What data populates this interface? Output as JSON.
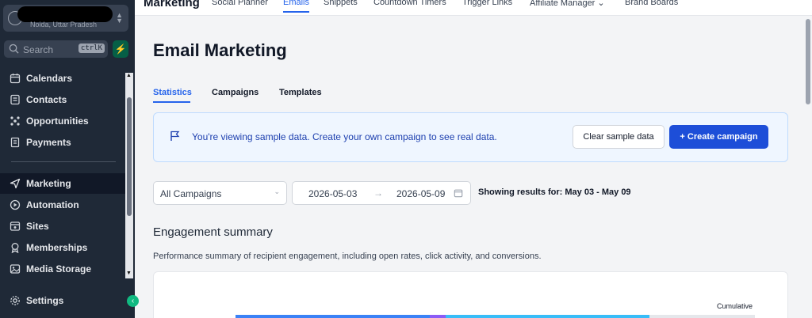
{
  "sidebar": {
    "account_location": "Noida, Uttar Pradesh",
    "search_placeholder": "Search",
    "search_shortcut": "ctrlK",
    "items": [
      {
        "label": "Calendars",
        "icon": "calendar-icon"
      },
      {
        "label": "Contacts",
        "icon": "contacts-icon"
      },
      {
        "label": "Opportunities",
        "icon": "opportunities-icon"
      },
      {
        "label": "Payments",
        "icon": "payments-icon"
      },
      {
        "label": "Marketing",
        "icon": "send-icon",
        "active": true
      },
      {
        "label": "Automation",
        "icon": "automation-icon"
      },
      {
        "label": "Sites",
        "icon": "sites-icon"
      },
      {
        "label": "Memberships",
        "icon": "memberships-icon"
      },
      {
        "label": "Media Storage",
        "icon": "media-icon"
      },
      {
        "label": "Settings",
        "icon": "gear-icon"
      }
    ]
  },
  "topnav": {
    "title": "Marketing",
    "items": [
      "Social Planner",
      "Emails",
      "Snippets",
      "Countdown Timers",
      "Trigger Links",
      "Affiliate Manager",
      "Brand Boards"
    ],
    "active": "Emails"
  },
  "main": {
    "title": "Email Marketing",
    "tabs": [
      "Statistics",
      "Campaigns",
      "Templates"
    ],
    "active_tab": "Statistics",
    "banner": {
      "message": "You're viewing sample data. Create your own campaign to see real data.",
      "clear_button": "Clear sample data",
      "create_button": "Create campaign"
    },
    "filter": {
      "campaign_select": "All Campaigns",
      "date_start": "2026-05-03",
      "date_end": "2026-05-09",
      "showing": "Showing results for: May 03 - May 09"
    },
    "engagement": {
      "title": "Engagement summary",
      "description": "Performance summary of recipient engagement, including open rates, click activity, and conversions.",
      "cumulative_label": "Cumulative"
    }
  },
  "colors": {
    "accent": "#2563eb",
    "sidebar_bg": "#1f2937",
    "banner_bg": "#eff6ff",
    "success": "#10b981"
  }
}
